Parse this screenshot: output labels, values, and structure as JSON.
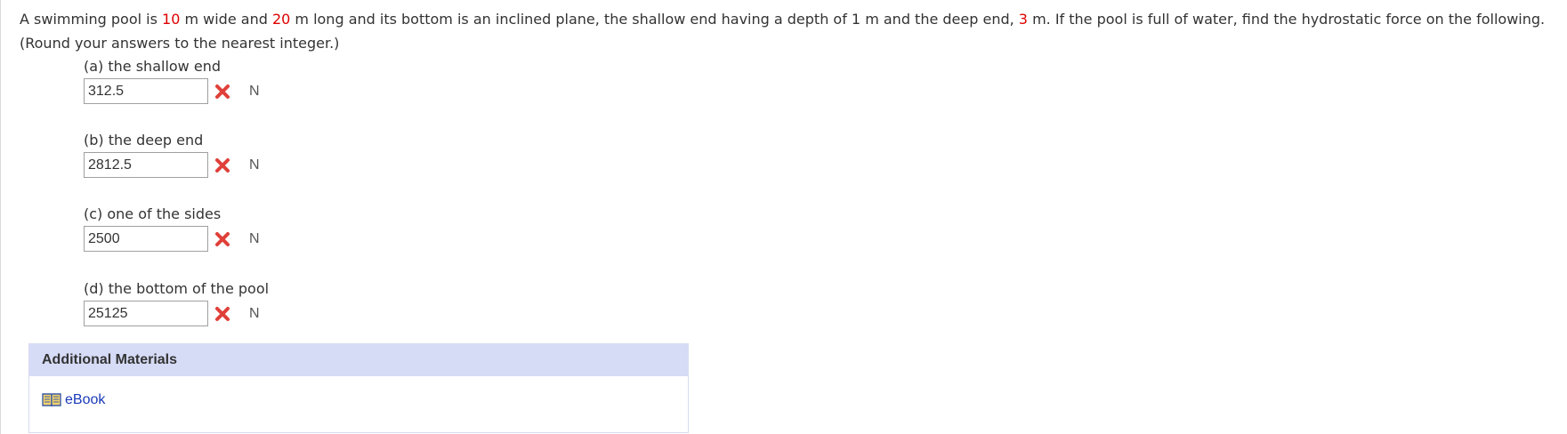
{
  "problem": {
    "text_1": "A swimming pool is ",
    "width": "10",
    "text_2": " m wide and ",
    "length": "20",
    "text_3": " m long and its bottom is an inclined plane, the shallow end having a depth of 1 m and the deep end, ",
    "deep_depth": "3",
    "text_4": " m. If the pool is full of water, find the hydrostatic force on the following. (Round your answers to the nearest integer.)",
    "highlight_color": "#e00000"
  },
  "parts": [
    {
      "label": "(a) the shallow end",
      "value": "312.5",
      "unit": "N",
      "status": "incorrect"
    },
    {
      "label": "(b) the deep end",
      "value": "2812.5",
      "unit": "N",
      "status": "incorrect"
    },
    {
      "label": "(c) one of the sides",
      "value": "2500",
      "unit": "N",
      "status": "incorrect"
    },
    {
      "label": "(d) the bottom of the pool",
      "value": "25125",
      "unit": "N",
      "status": "incorrect"
    }
  ],
  "materials": {
    "header": "Additional Materials",
    "ebook_label": "eBook",
    "header_color": "#d6dcf6",
    "link_color": "#1a3ab8"
  },
  "icons": {
    "wrong": "x-mark-icon",
    "ebook": "book-icon"
  }
}
